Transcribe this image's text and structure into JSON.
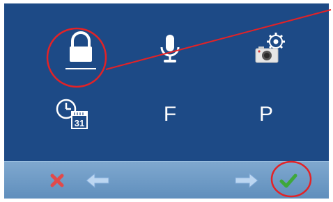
{
  "screen": {
    "background": "#1d4a86",
    "menu": {
      "row1": [
        {
          "icon": "lock-icon",
          "label": ""
        },
        {
          "icon": "microphone-icon",
          "label": ""
        },
        {
          "icon": "camera-settings-icon",
          "label": ""
        }
      ],
      "row2": [
        {
          "icon": "clock-calendar-icon",
          "calendar_day": "31"
        },
        {
          "label": "F"
        },
        {
          "label": "P"
        }
      ]
    },
    "toolbar": {
      "cancel_icon": "close-x-icon",
      "back_icon": "arrow-left-icon",
      "forward_icon": "arrow-right-icon",
      "confirm_icon": "checkmark-icon"
    }
  },
  "annotations": {
    "highlight_color": "#e32226"
  }
}
